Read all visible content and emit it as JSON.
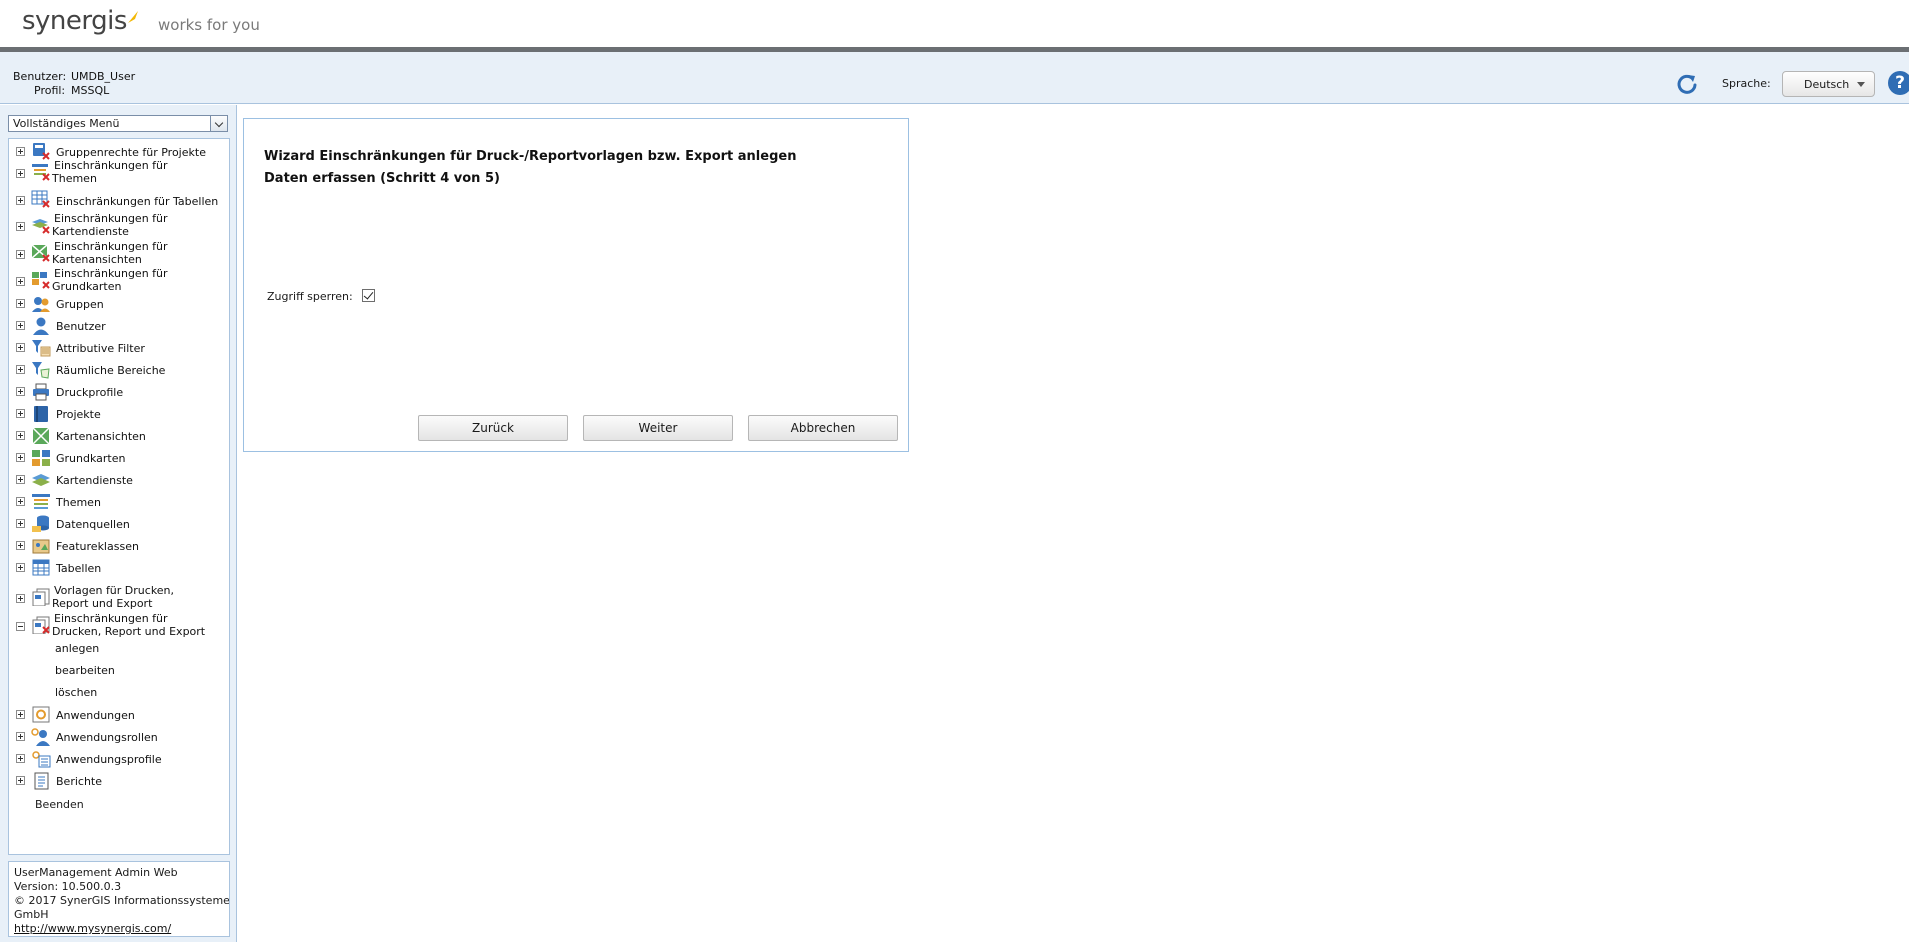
{
  "brand": {
    "logo": "synergis",
    "tagline": "works for you"
  },
  "header": {
    "user_label": "Benutzer:",
    "user_value": "UMDB_User",
    "profile_label": "Profil:",
    "profile_value": "MSSQL",
    "language_label": "Sprache:",
    "language_value": "Deutsch",
    "help_symbol": "?"
  },
  "sidebar": {
    "menu_select": "Vollständiges Menü",
    "items": [
      {
        "label": "Gruppenrechte für Projekte",
        "icon": "group-rights-projects-icon"
      },
      {
        "label": "Einschränkungen für",
        "label2": "Themen",
        "icon": "restriction-themes-icon"
      },
      {
        "label": "Einschränkungen für Tabellen",
        "icon": "restriction-tables-icon"
      },
      {
        "label": "Einschränkungen für",
        "label2": "Kartendienste",
        "icon": "restriction-mapservices-icon"
      },
      {
        "label": "Einschränkungen für",
        "label2": "Kartenansichten",
        "icon": "restriction-mapviews-icon"
      },
      {
        "label": "Einschränkungen für",
        "label2": "Grundkarten",
        "icon": "restriction-basemaps-icon"
      },
      {
        "label": "Gruppen",
        "icon": "groups-icon"
      },
      {
        "label": "Benutzer",
        "icon": "user-icon"
      },
      {
        "label": "Attributive Filter",
        "icon": "attribute-filter-icon"
      },
      {
        "label": "Räumliche Bereiche",
        "icon": "spatial-filter-icon"
      },
      {
        "label": "Druckprofile",
        "icon": "printer-icon"
      },
      {
        "label": "Projekte",
        "icon": "project-book-icon"
      },
      {
        "label": "Kartenansichten",
        "icon": "mapview-icon"
      },
      {
        "label": "Grundkarten",
        "icon": "basemap-icon"
      },
      {
        "label": "Kartendienste",
        "icon": "mapservice-icon"
      },
      {
        "label": "Themen",
        "icon": "themes-icon"
      },
      {
        "label": "Datenquellen",
        "icon": "datasource-icon"
      },
      {
        "label": "Featureklassen",
        "icon": "featureclass-icon"
      },
      {
        "label": "Tabellen",
        "icon": "table-icon"
      },
      {
        "label": "Vorlagen für Drucken,",
        "label2": "Report und Export",
        "icon": "templates-icon"
      },
      {
        "label": "Einschränkungen für",
        "label2": "Drucken, Report und Export",
        "icon": "restriction-templates-icon"
      }
    ],
    "sub_items": [
      "anlegen",
      "bearbeiten",
      "löschen"
    ],
    "items_after": [
      {
        "label": "Anwendungen",
        "icon": "applications-icon"
      },
      {
        "label": "Anwendungsrollen",
        "icon": "application-roles-icon"
      },
      {
        "label": "Anwendungsprofile",
        "icon": "application-profiles-icon"
      },
      {
        "label": "Berichte",
        "icon": "reports-icon"
      }
    ],
    "exit_label": "Beenden"
  },
  "footer": {
    "line1": "UserManagement Admin Web",
    "line2": "Version: 10.500.0.3",
    "line3": "© 2017 SynerGIS Informationssysteme",
    "line4": "GmbH",
    "link": "http://www.mysynergis.com/"
  },
  "wizard": {
    "title": "Wizard Einschränkungen für Druck-/Reportvorlagen bzw. Export anlegen",
    "subtitle": "Daten erfassen (Schritt 4 von 5)",
    "field_label": "Zugriff sperren:",
    "checked": true,
    "back_label": "Zurück",
    "next_label": "Weiter",
    "cancel_label": "Abbrechen"
  },
  "colors": {
    "accent": "#2f6db4",
    "panel_bg": "#e8f0f8",
    "border": "#a9c3de",
    "brand_bar": "#6b6f73",
    "brand_spark": "#f2b705"
  }
}
